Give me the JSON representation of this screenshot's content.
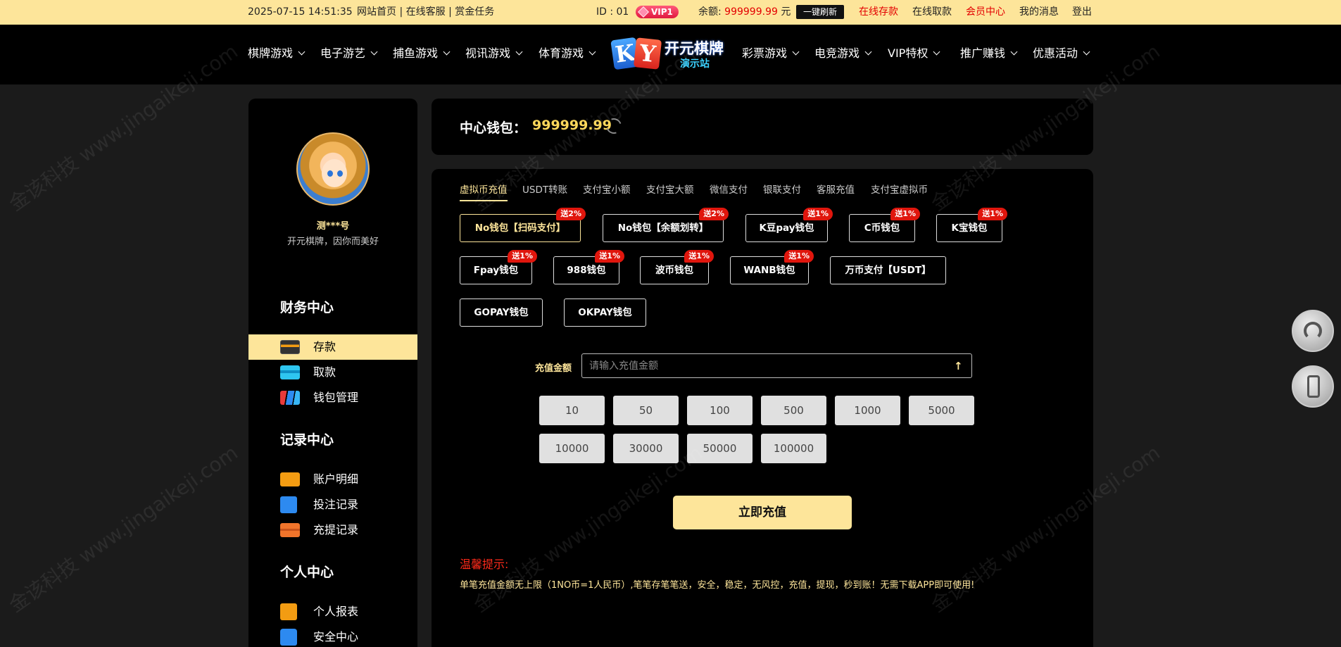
{
  "topbar": {
    "datetime": "2025-07-15 14:51:35",
    "links": [
      "网站首页",
      "在线客服",
      "赏金任务"
    ],
    "separator": " | ",
    "id_text": "ID : 01",
    "vip": "VIP1",
    "balance_label": "余额:",
    "balance_value": "999999.99",
    "balance_unit": "元",
    "refresh_label": "一键刷新",
    "right_links": [
      "在线存款",
      "在线取款",
      "会员中心",
      "我的消息",
      "登出"
    ]
  },
  "nav": {
    "left": [
      "棋牌游戏",
      "电子游艺",
      "捕鱼游戏",
      "视讯游戏",
      "体育游戏"
    ],
    "right": [
      "彩票游戏",
      "电竞游戏",
      "VIP特权",
      "推广赚钱",
      "优惠活动"
    ],
    "logo_text": "开元棋牌",
    "logo_sub": "演示站",
    "logo_letters": "KY"
  },
  "sidebar": {
    "username": "测***号",
    "slogan": "开元棋牌，因你而美好",
    "sections": {
      "finance": "财务中心",
      "records": "记录中心",
      "personal": "个人中心"
    },
    "items": {
      "deposit": "存款",
      "withdraw": "取款",
      "wallet": "钱包管理",
      "account": "账户明细",
      "bets": "投注记录",
      "recharge": "充提记录",
      "report": "个人报表",
      "security": "安全中心"
    }
  },
  "wallet": {
    "label": "中心钱包：",
    "amount": "999999.99"
  },
  "tabs": [
    "虚拟币充值",
    "USDT转账",
    "支付宝小额",
    "支付宝大额",
    "微信支付",
    "银联支付",
    "客服充值",
    "支付宝虚拟币"
  ],
  "pay_methods": [
    {
      "label": "No钱包【扫码支付】",
      "badge": "送2%"
    },
    {
      "label": "No钱包【余额划转】",
      "badge": "送2%"
    },
    {
      "label": "K豆pay钱包",
      "badge": "送1%"
    },
    {
      "label": "C币钱包",
      "badge": "送1%"
    },
    {
      "label": "K宝钱包",
      "badge": "送1%"
    },
    {
      "label": "Fpay钱包",
      "badge": "送1%"
    },
    {
      "label": "988钱包",
      "badge": "送1%"
    },
    {
      "label": "波币钱包",
      "badge": "送1%"
    },
    {
      "label": "WANB钱包",
      "badge": "送1%"
    },
    {
      "label": "万币支付【USDT】",
      "badge": ""
    },
    {
      "label": "GOPAY钱包",
      "badge": ""
    },
    {
      "label": "OKPAY钱包",
      "badge": ""
    }
  ],
  "form": {
    "amount_label": "充值金额",
    "amount_placeholder": "请输入充值金额",
    "amounts": [
      "10",
      "50",
      "100",
      "500",
      "1000",
      "5000",
      "10000",
      "30000",
      "50000",
      "100000"
    ],
    "submit": "立即充值"
  },
  "tips": {
    "title": "温馨提示:",
    "text": "单笔充值金额无上限（1NO币=1人民币）,笔笔存笔笔送，安全，稳定，无风控，充值，提现，秒到账！无需下载APP即可使用!"
  },
  "watermark": "金该科技 www.jingaikeji.com"
}
